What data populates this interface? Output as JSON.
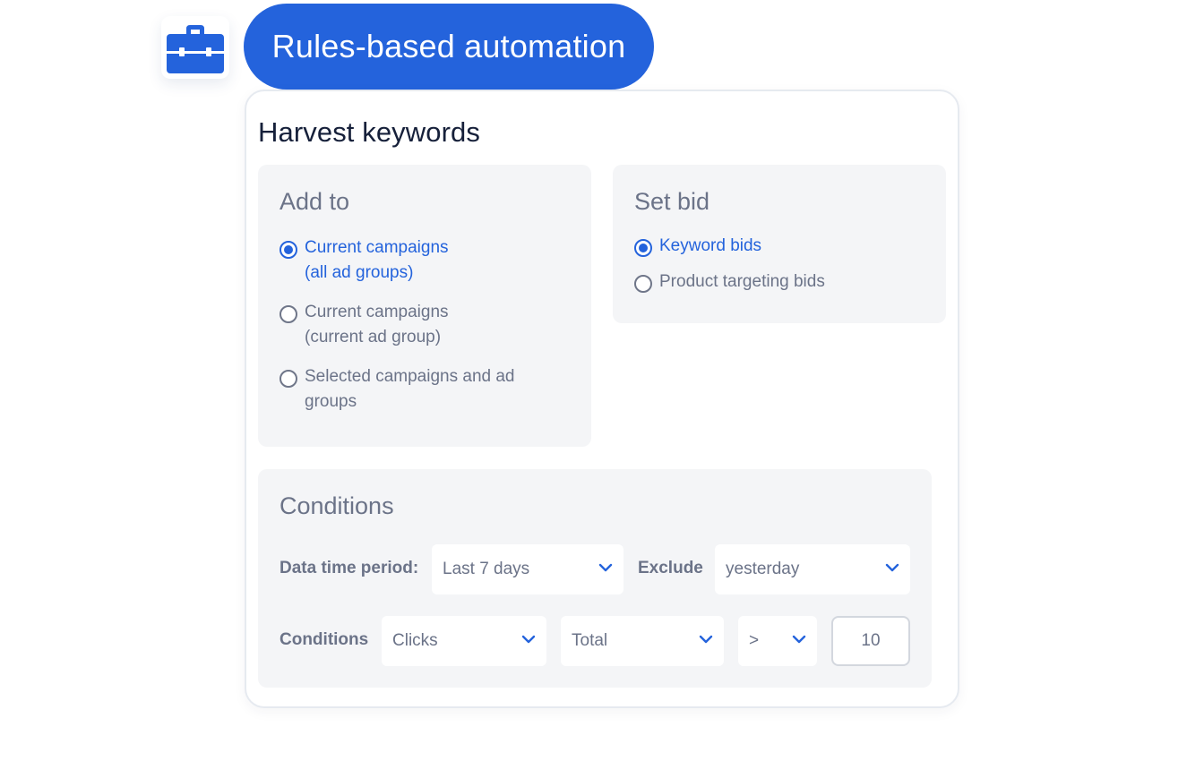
{
  "header": {
    "icon": "toolbox-icon",
    "title": "Rules-based automation"
  },
  "card": {
    "title": "Harvest keywords",
    "add_to": {
      "title": "Add to",
      "options": [
        {
          "label": "Current campaigns\n(all ad groups)",
          "selected": true
        },
        {
          "label": "Current campaigns\n(current ad group)",
          "selected": false
        },
        {
          "label": "Selected campaigns and ad\ngroups",
          "selected": false
        }
      ]
    },
    "set_bid": {
      "title": "Set bid",
      "options": [
        {
          "label": "Keyword bids",
          "selected": true
        },
        {
          "label": "Product targeting bids",
          "selected": false
        }
      ]
    },
    "conditions": {
      "title": "Conditions",
      "data_time_period_label": "Data time period:",
      "data_time_period_value": "Last 7 days",
      "exclude_label": "Exclude",
      "exclude_value": "yesterday",
      "conditions_label": "Conditions",
      "metric_value": "Clicks",
      "aggregate_value": "Total",
      "operator_value": ">",
      "threshold_value": "10"
    }
  },
  "colors": {
    "accent": "#2463dc",
    "panel_bg": "#f4f5f7",
    "muted_text": "#6b7388"
  }
}
